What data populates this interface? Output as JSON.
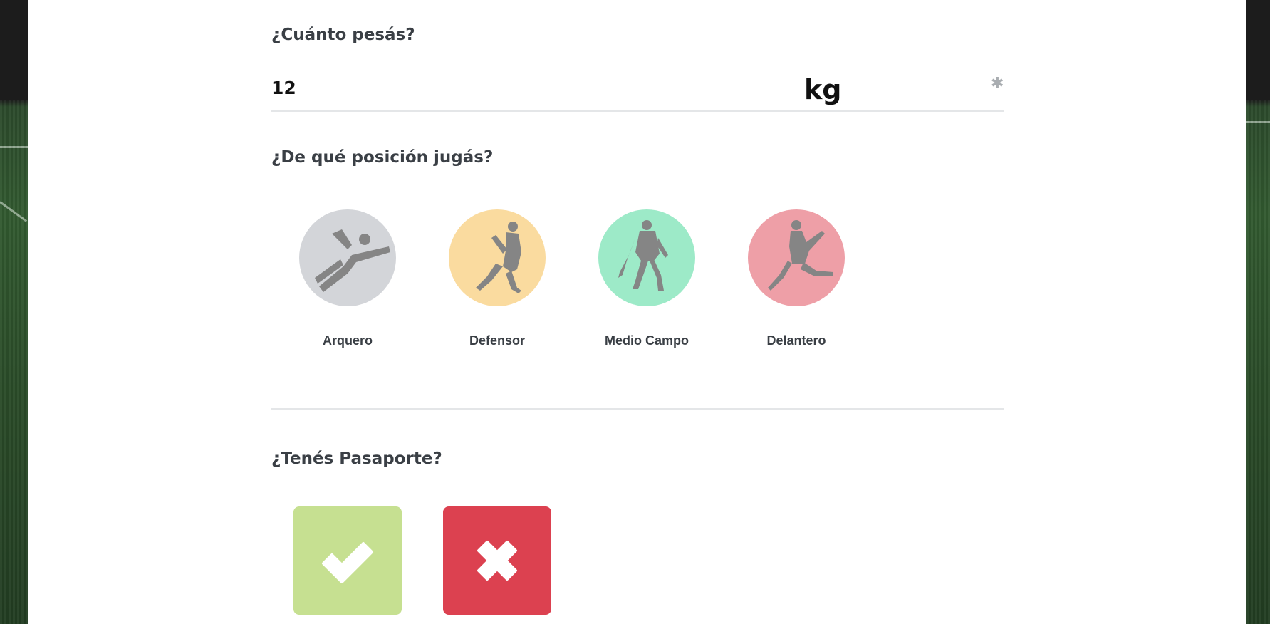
{
  "weight": {
    "question": "¿Cuánto pesás?",
    "value": "12",
    "unit": "kg",
    "required_mark": "✱"
  },
  "position": {
    "question": "¿De qué posición jugás?",
    "options": [
      {
        "label": "Arquero",
        "color": "#d3d5d9",
        "icon": "goalkeeper-icon"
      },
      {
        "label": "Defensor",
        "color": "#fadb9f",
        "icon": "defender-icon"
      },
      {
        "label": "Medio Campo",
        "color": "#9deac8",
        "icon": "midfielder-icon"
      },
      {
        "label": "Delantero",
        "color": "#ee9fa7",
        "icon": "forward-icon"
      }
    ]
  },
  "passport": {
    "question": "¿Tenés Pasaporte?",
    "yes": {
      "icon": "check-icon",
      "color": "#c6e091"
    },
    "no": {
      "icon": "close-icon",
      "color": "#dc4150"
    }
  }
}
